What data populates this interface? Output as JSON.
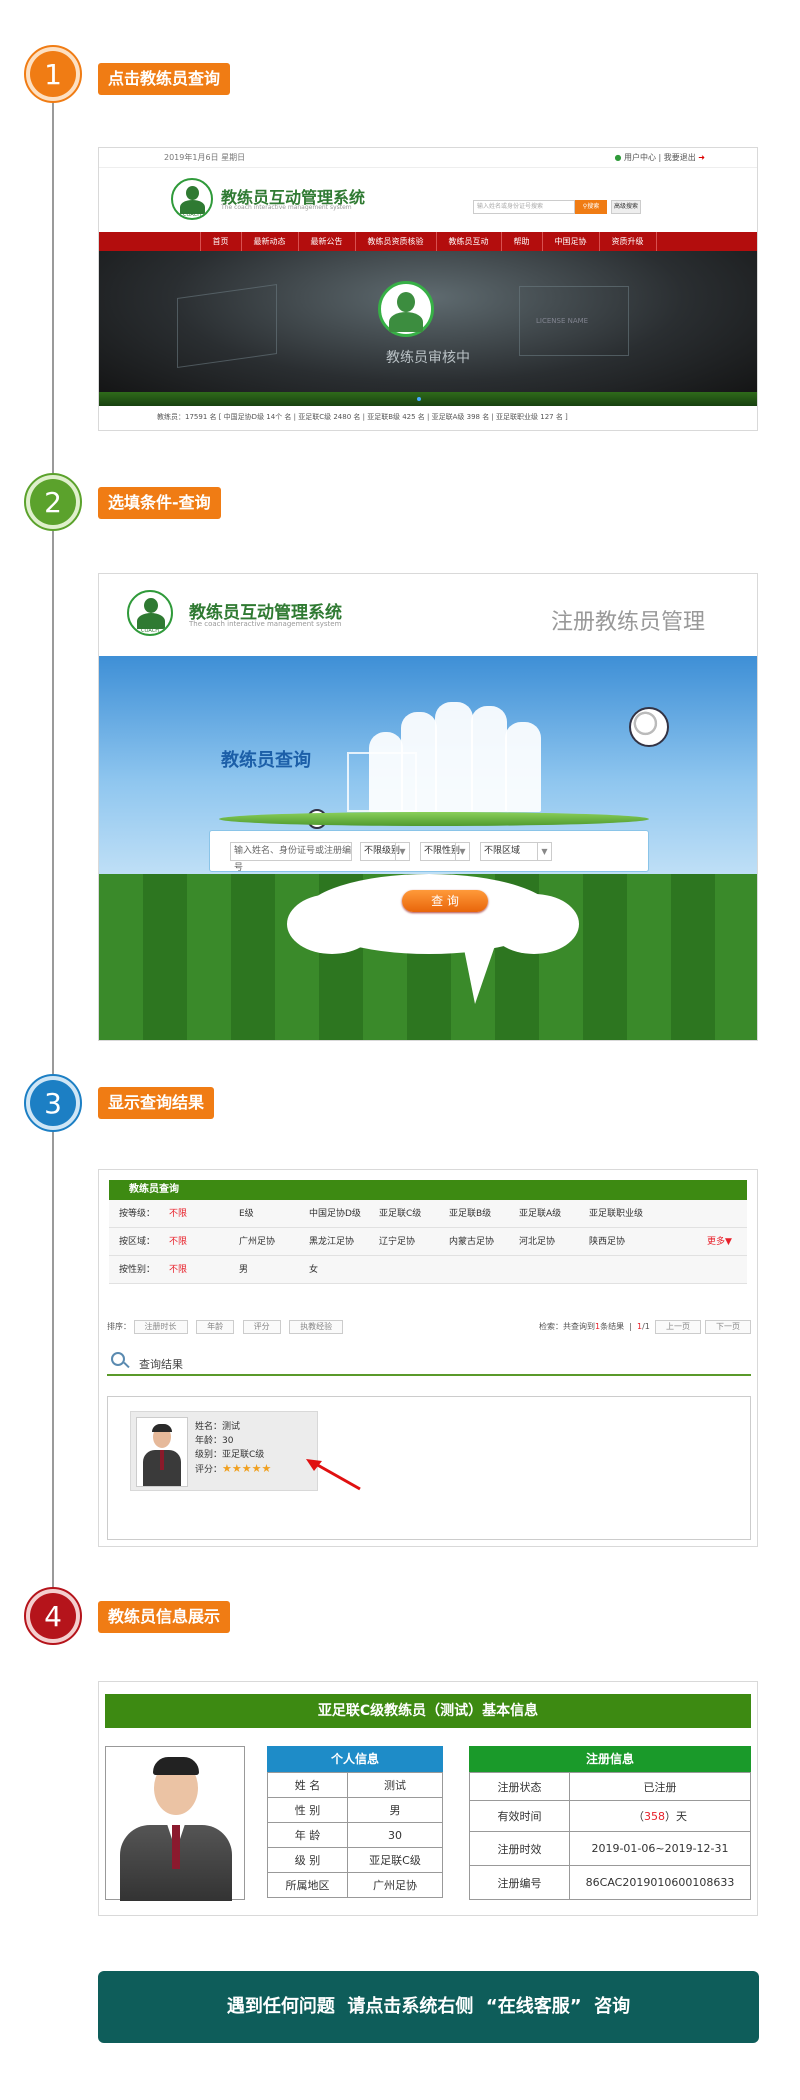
{
  "steps": [
    {
      "num": "1",
      "label": "点击教练员查询",
      "color": "#f07c14"
    },
    {
      "num": "2",
      "label": "选填条件-查询",
      "color": "#5ba22c"
    },
    {
      "num": "3",
      "label": "显示查询结果",
      "color": "#1c7fc4"
    },
    {
      "num": "4",
      "label": "教练员信息展示",
      "color": "#b5141b"
    }
  ],
  "screen1": {
    "date": "2019年1月6日   星期日",
    "user_center": "用户中心",
    "logout": "我要退出",
    "logo_title": "教练员互动管理系统",
    "logo_sub": "The coach interactive management system",
    "logo_badge": "COACH",
    "search_placeholder": "输入姓名或身份证号搜索",
    "search_btn": "搜索",
    "advanced_btn": "高级搜索",
    "nav": [
      "首页",
      "最新动态",
      "最新公告",
      "教练员资质核验",
      "教练员互动",
      "帮助",
      "中国足协",
      "资质升级"
    ],
    "banner_text": "教练员审核中",
    "license_text": "LICENSE NAME",
    "stats": "教练员：17591 名    [ 中国足协D级 14个 名  |  亚足联C级 2480 名  |  亚足联B级 425 名  |  亚足联A级 398 名  |  亚足联职业级 127 名 ]"
  },
  "screen2": {
    "logo_title": "教练员互动管理系统",
    "logo_sub": "The coach interactive management system",
    "logo_badge": "COACH",
    "page_title": "注册教练员管理",
    "query_title": "教练员查询",
    "input_placeholder": "输入姓名、身份证号或注册编号",
    "level_select": "不限级别",
    "gender_select": "不限性别",
    "region_select": "不限区域",
    "query_btn": "查 询"
  },
  "screen3": {
    "header": "教练员查询",
    "filters": [
      {
        "label": "按等级：",
        "active": "不限",
        "options": [
          "E级",
          "中国足协D级",
          "亚足联C级",
          "亚足联B级",
          "亚足联A级",
          "亚足联职业级"
        ],
        "more": ""
      },
      {
        "label": "按区域：",
        "active": "不限",
        "options": [
          "广州足协",
          "黑龙江足协",
          "辽宁足协",
          "内蒙古足协",
          "河北足协",
          "陕西足协"
        ],
        "more": "更多▼"
      },
      {
        "label": "按性别：",
        "active": "不限",
        "options": [
          "男",
          "女"
        ],
        "more": ""
      }
    ],
    "sort_label": "排序：",
    "sort_options": [
      "注册时长",
      "年龄",
      "评分",
      "执教经验"
    ],
    "result_info_prefix": "检索：共查询到",
    "result_count": "1",
    "result_info_suffix": "条结果",
    "page_current": "1",
    "page_total": "/1",
    "prev_btn": "上一页",
    "next_btn": "下一页",
    "results_title": "查询结果",
    "card": {
      "name": "姓名：测试",
      "age": "年龄：30",
      "level": "级别：亚足联C级",
      "rating_label": "评分：",
      "stars": 5
    }
  },
  "screen4": {
    "title": "亚足联C级教练员（测试）基本信息",
    "personal_header": "个人信息",
    "personal": [
      {
        "k": "姓 名",
        "v": "测试"
      },
      {
        "k": "性 别",
        "v": "男"
      },
      {
        "k": "年 龄",
        "v": "30"
      },
      {
        "k": "级 别",
        "v": "亚足联C级"
      },
      {
        "k": "所属地区",
        "v": "广州足协"
      }
    ],
    "reg_header": "注册信息",
    "reg": [
      {
        "k": "注册状态",
        "v": "已注册"
      },
      {
        "k": "有效时间",
        "v_pre": "（",
        "v_num": "358",
        "v_post": "）天"
      },
      {
        "k": "注册时效",
        "v": "2019-01-06~2019-12-31"
      },
      {
        "k": "注册编号",
        "v": "86CAC2019010600108633"
      }
    ]
  },
  "footer": {
    "text": "遇到任何问题  请点击系统右侧  “在线客服”  咨询"
  },
  "colors": {
    "orange": "#f07c14",
    "green_header": "#3d8a12",
    "blue_header": "#1e8cc8",
    "red_nav": "#b30d0d",
    "footer_bg": "#0e5d5a"
  }
}
